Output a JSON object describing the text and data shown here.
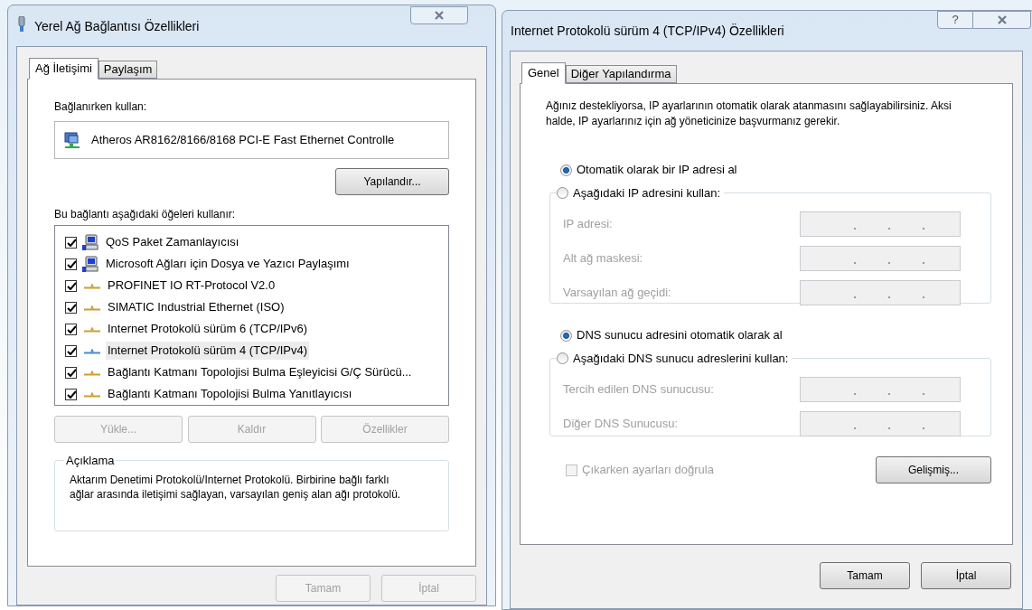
{
  "left_window": {
    "title": "Yerel Ağ Bağlantısı Özellikleri",
    "tabs": [
      {
        "label": "Ağ İletişimi",
        "selected": true
      },
      {
        "label": "Paylaşım",
        "selected": false
      }
    ],
    "connect_using_label": "Bağlanırken kullan:",
    "adapter": "Atheros AR8162/8166/8168 PCI-E Fast Ethernet Controlle",
    "configure_button": "Yapılandır...",
    "items_label": "Bu bağlantı aşağıdaki öğeleri kullanır:",
    "items": [
      {
        "kind": "client",
        "label": "QoS Paket Zamanlayıcısı",
        "checked": true,
        "selected": false
      },
      {
        "kind": "client",
        "label": "Microsoft Ağları için Dosya ve Yazıcı Paylaşımı",
        "checked": true,
        "selected": false
      },
      {
        "kind": "protocol",
        "label": "PROFINET IO RT-Protocol V2.0",
        "checked": true,
        "selected": false
      },
      {
        "kind": "protocol",
        "label": "SIMATIC Industrial Ethernet (ISO)",
        "checked": true,
        "selected": false
      },
      {
        "kind": "protocol",
        "label": "Internet Protokolü sürüm 6 (TCP/IPv6)",
        "checked": true,
        "selected": false
      },
      {
        "kind": "protocol",
        "label": "Internet Protokolü sürüm 4 (TCP/IPv4)",
        "checked": true,
        "selected": true
      },
      {
        "kind": "protocol",
        "label": "Bağlantı Katmanı Topolojisi Bulma Eşleyicisi G/Ç Sürücü...",
        "checked": true,
        "selected": false
      },
      {
        "kind": "protocol",
        "label": "Bağlantı Katmanı Topolojisi Bulma Yanıtlayıcısı",
        "checked": true,
        "selected": false
      }
    ],
    "item_buttons": [
      {
        "label": "Yükle...",
        "disabled": true
      },
      {
        "label": "Kaldır",
        "disabled": true
      },
      {
        "label": "Özellikler",
        "disabled": true
      }
    ],
    "description": {
      "title": "Açıklama",
      "text": "Aktarım Denetimi Protokolü/Internet Protokolü. Birbirine bağlı farklı ağlar arasında iletişimi sağlayan, varsayılan geniş alan ağı protokolü."
    },
    "buttons": [
      {
        "label": "Tamam",
        "disabled": true
      },
      {
        "label": "İptal",
        "disabled": true
      }
    ]
  },
  "right_window": {
    "title": "Internet Protokolü sürüm 4 (TCP/IPv4) Özellikleri",
    "title_buttons": [
      "?"
    ],
    "tabs": [
      {
        "label": "Genel",
        "selected": true
      },
      {
        "label": "Diğer Yapılandırma",
        "selected": false
      }
    ],
    "intro": "Ağınız destekliyorsa, IP ayarlarının otomatik olarak atanmasını sağlayabilirsiniz. Aksi halde, IP ayarlarınız için ağ yöneticinize başvurmanız gerekir.",
    "ip_options": [
      {
        "label": "Otomatik olarak bir IP adresi al",
        "selected": true
      },
      {
        "label": "Aşağıdaki IP adresini kullan:",
        "selected": false
      }
    ],
    "ip_fields": [
      {
        "label": "IP adresi:",
        "disabled": true
      },
      {
        "label": "Alt ağ maskesi:",
        "disabled": true
      },
      {
        "label": "Varsayılan ağ geçidi:",
        "disabled": true
      }
    ],
    "dns_options": [
      {
        "label": "DNS sunucu adresini otomatik olarak al",
        "selected": true
      },
      {
        "label": "Aşağıdaki DNS sunucu adreslerini kullan:",
        "selected": false
      }
    ],
    "dns_fields": [
      {
        "label": "Tercih edilen DNS sunucusu:",
        "disabled": true
      },
      {
        "label": "Diğer DNS Sunucusu:",
        "disabled": true
      }
    ],
    "validate": {
      "label": "Çıkarken ayarları doğrula",
      "checked": false,
      "disabled": true
    },
    "advanced_button": "Gelişmiş...",
    "buttons": [
      {
        "label": "Tamam",
        "disabled": false
      },
      {
        "label": "İptal",
        "disabled": false
      }
    ]
  }
}
